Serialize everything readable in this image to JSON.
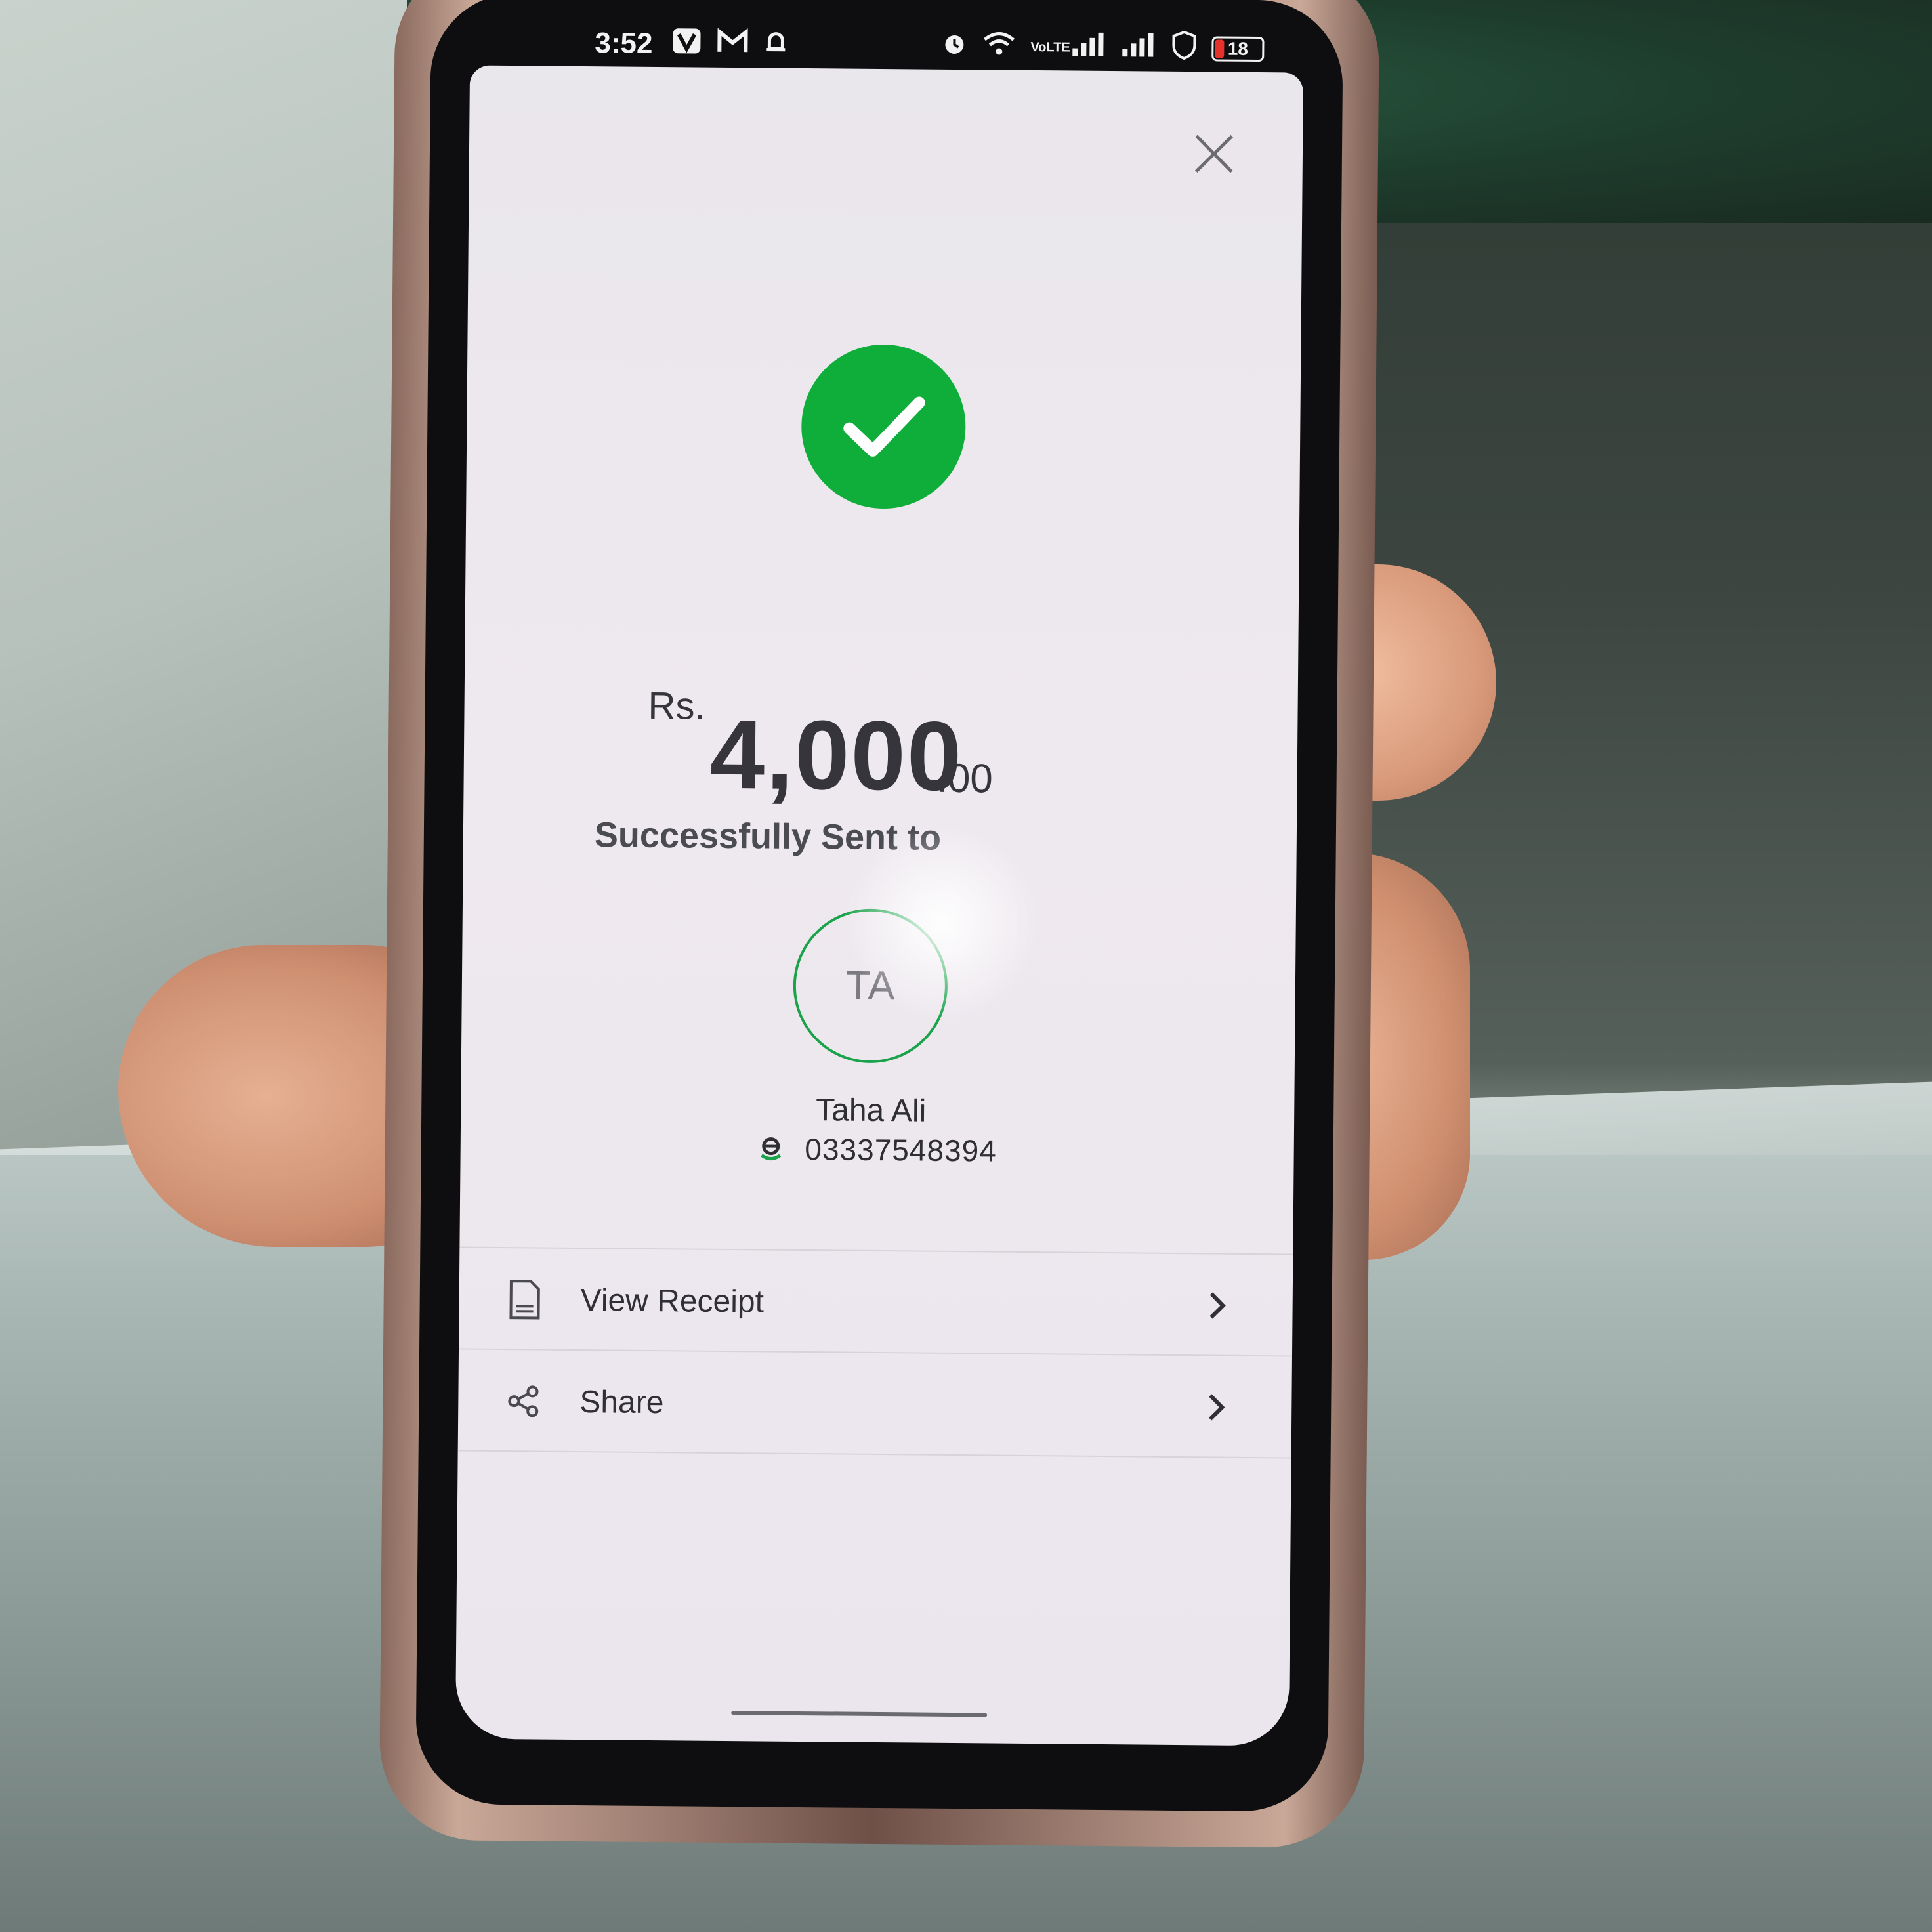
{
  "status_bar": {
    "time": "3:52",
    "icons_left": [
      "v-icon",
      "gmail-icon",
      "bell-icon"
    ],
    "icons_right": [
      "alarm-icon",
      "wifi-icon",
      "volte-icon",
      "signal-icon",
      "signal-icon",
      "shield-icon"
    ],
    "battery": "18",
    "volte_label": "VoLTE"
  },
  "screen": {
    "close_icon": "close-icon",
    "success_icon": "check-icon",
    "success_color": "#0fae3a",
    "amount": {
      "currency": "Rs.",
      "major": "4,000",
      "minor": ".00"
    },
    "status_text": "Successfully Sent to",
    "recipient": {
      "initials": "TA",
      "name": "Taha Ali",
      "number": "03337548394",
      "wallet_icon": "easypaisa-icon"
    },
    "actions": [
      {
        "label": "View Receipt",
        "icon": "receipt-icon"
      },
      {
        "label": "Share",
        "icon": "share-icon"
      }
    ],
    "accent_color": "#1aa34a"
  }
}
